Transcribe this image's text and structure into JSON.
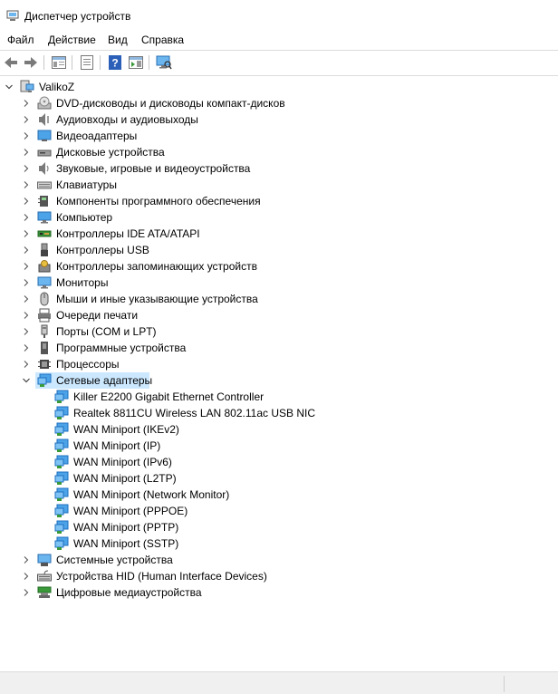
{
  "window": {
    "title": "Диспетчер устройств"
  },
  "menu": {
    "file": "Файл",
    "action": "Действие",
    "view": "Вид",
    "help": "Справка"
  },
  "tree": {
    "root": "ValikoZ",
    "categories": [
      {
        "label": "DVD-дисководы и дисководы компакт-дисков",
        "icon": "dvd-drive-icon"
      },
      {
        "label": "Аудиовходы и аудиовыходы",
        "icon": "speaker-icon"
      },
      {
        "label": "Видеоадаптеры",
        "icon": "display-adapter-icon"
      },
      {
        "label": "Дисковые устройства",
        "icon": "disk-drive-icon"
      },
      {
        "label": "Звуковые, игровые и видеоустройства",
        "icon": "sound-icon"
      },
      {
        "label": "Клавиатуры",
        "icon": "keyboard-icon"
      },
      {
        "label": "Компоненты программного обеспечения",
        "icon": "software-component-icon"
      },
      {
        "label": "Компьютер",
        "icon": "computer-icon"
      },
      {
        "label": "Контроллеры IDE ATA/ATAPI",
        "icon": "ide-controller-icon"
      },
      {
        "label": "Контроллеры USB",
        "icon": "usb-icon"
      },
      {
        "label": "Контроллеры запоминающих устройств",
        "icon": "storage-controller-icon"
      },
      {
        "label": "Мониторы",
        "icon": "monitor-icon"
      },
      {
        "label": "Мыши и иные указывающие устройства",
        "icon": "mouse-icon"
      },
      {
        "label": "Очереди печати",
        "icon": "printer-icon"
      },
      {
        "label": "Порты (COM и LPT)",
        "icon": "port-icon"
      },
      {
        "label": "Программные устройства",
        "icon": "software-device-icon"
      },
      {
        "label": "Процессоры",
        "icon": "processor-icon"
      },
      {
        "label": "Сетевые адаптеры",
        "icon": "network-adapter-icon",
        "expanded": true,
        "selected": true
      },
      {
        "label": "Системные устройства",
        "icon": "system-device-icon"
      },
      {
        "label": "Устройства HID (Human Interface Devices)",
        "icon": "hid-icon"
      },
      {
        "label": "Цифровые медиаустройства",
        "icon": "media-device-icon"
      }
    ],
    "network_adapters": [
      "Killer E2200 Gigabit Ethernet Controller",
      "Realtek 8811CU Wireless LAN 802.11ac USB NIC",
      "WAN Miniport (IKEv2)",
      "WAN Miniport (IP)",
      "WAN Miniport (IPv6)",
      "WAN Miniport (L2TP)",
      "WAN Miniport (Network Monitor)",
      "WAN Miniport (PPPOE)",
      "WAN Miniport (PPTP)",
      "WAN Miniport (SSTP)"
    ]
  },
  "colors": {
    "selection": "#cce8ff",
    "network_icon": "#1e88d8"
  }
}
